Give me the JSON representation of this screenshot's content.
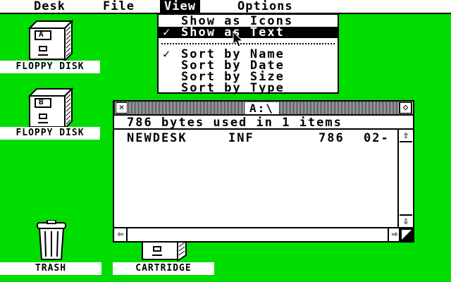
{
  "menubar": {
    "items": [
      "Desk",
      "File",
      "View",
      "Options"
    ]
  },
  "view_menu": {
    "items": [
      {
        "label": "Show as Icons",
        "checked": false,
        "selected": false
      },
      {
        "label": "Show as Text",
        "checked": true,
        "selected": true
      },
      {
        "label": "Sort by Name",
        "checked": true,
        "selected": false
      },
      {
        "label": "Sort by Date",
        "checked": false,
        "selected": false
      },
      {
        "label": "Sort by Size",
        "checked": false,
        "selected": false
      },
      {
        "label": "Sort by Type",
        "checked": false,
        "selected": false
      }
    ],
    "check_glyph": "✓"
  },
  "desktop": {
    "background": "#00dd00",
    "icons": [
      {
        "label": "FLOPPY DISK",
        "letter": "A",
        "icon": "floppy-drive-icon"
      },
      {
        "label": "FLOPPY DISK",
        "letter": "B",
        "icon": "floppy-drive-icon"
      },
      {
        "label": "TRASH",
        "icon": "trash-icon"
      },
      {
        "label": "CARTRIDGE",
        "icon": "cartridge-icon"
      }
    ]
  },
  "window": {
    "title": "A:\\",
    "info": "786 bytes used in 1 items",
    "files": [
      {
        "name": "NEWDESK",
        "ext": "INF",
        "size": "786",
        "date": "02-"
      }
    ],
    "glyphs": {
      "close": "✕",
      "full": "◇",
      "up": "⇧",
      "down": "⇩",
      "left": "⇦",
      "right": "⇨"
    }
  }
}
